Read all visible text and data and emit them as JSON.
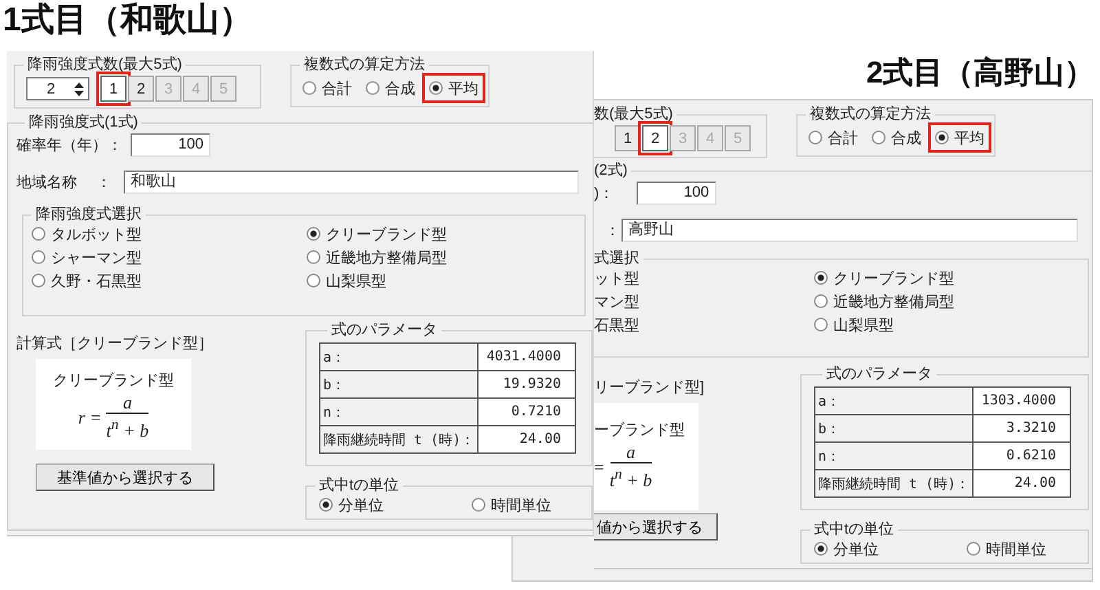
{
  "front_window": {
    "heading": "1式目（和歌山）",
    "count_group": {
      "label": "降雨強度式数(最大5式)",
      "spinner_value": "2",
      "buttons": [
        {
          "label": "1",
          "selected": true,
          "disabled": false,
          "highlighted": true
        },
        {
          "label": "2",
          "selected": false,
          "disabled": false,
          "highlighted": false
        },
        {
          "label": "3",
          "selected": false,
          "disabled": true,
          "highlighted": false
        },
        {
          "label": "4",
          "selected": false,
          "disabled": true,
          "highlighted": false
        },
        {
          "label": "5",
          "selected": false,
          "disabled": true,
          "highlighted": false
        }
      ]
    },
    "method_group": {
      "label": "複数式の算定方法",
      "options": [
        {
          "label": "合計",
          "selected": false,
          "highlighted": false
        },
        {
          "label": "合成",
          "selected": false,
          "highlighted": false
        },
        {
          "label": "平均",
          "selected": true,
          "highlighted": true
        }
      ]
    },
    "formula_group": {
      "label": "降雨強度式(1式)",
      "return_period": {
        "label": "確率年（年）：",
        "value": "100"
      },
      "region": {
        "label": "地域名称",
        "colon": "：",
        "value": "和歌山"
      },
      "type_group": {
        "label": "降雨強度式選択",
        "options": [
          {
            "kind": "radio",
            "label": "タルボット型",
            "selected": false
          },
          {
            "kind": "radio",
            "label": "クリーブランド型",
            "selected": true
          },
          {
            "kind": "radio",
            "label": "シャーマン型",
            "selected": false
          },
          {
            "kind": "radio",
            "label": "近畿地方整備局型",
            "selected": false
          },
          {
            "kind": "radio",
            "label": "久野・石黒型",
            "selected": false
          },
          {
            "kind": "radio",
            "label": "山梨県型",
            "selected": false
          }
        ]
      },
      "calc_label": "計算式［クリーブランド型］",
      "formula": {
        "name": "クリーブランド型",
        "lhs": "r",
        "equals": "=",
        "numerator": "a",
        "denominator": "t$^{n}$ + b"
      },
      "select_button": "基準値から選択する",
      "params": {
        "label": "式のパラメータ",
        "rows": [
          {
            "name": "a：",
            "value": "4031.4000"
          },
          {
            "name": "b：",
            "value": "19.9320"
          },
          {
            "name": "n：",
            "value": "0.7210"
          },
          {
            "name": "降雨継続時間 t (時)：",
            "value": "24.00"
          }
        ]
      },
      "unit_group": {
        "label": "式中tの単位",
        "options": [
          {
            "label": "分単位",
            "selected": true
          },
          {
            "label": "時間単位",
            "selected": false
          }
        ]
      }
    }
  },
  "back_window": {
    "heading": "2式目（高野山）",
    "count_group": {
      "label": "数(最大5式)",
      "buttons": [
        {
          "label": "1",
          "selected": false,
          "disabled": false,
          "highlighted": false
        },
        {
          "label": "2",
          "selected": true,
          "disabled": false,
          "highlighted": true
        },
        {
          "label": "3",
          "selected": false,
          "disabled": true,
          "highlighted": false
        },
        {
          "label": "4",
          "selected": false,
          "disabled": true,
          "highlighted": false
        },
        {
          "label": "5",
          "selected": false,
          "disabled": true,
          "highlighted": false
        }
      ]
    },
    "method_group": {
      "label": "複数式の算定方法",
      "options": [
        {
          "label": "合計",
          "selected": false,
          "highlighted": false
        },
        {
          "label": "合成",
          "selected": false,
          "highlighted": false
        },
        {
          "label": "平均",
          "selected": true,
          "highlighted": true
        }
      ]
    },
    "formula_group": {
      "label": "(2式)",
      "return_period": {
        "label": ")：",
        "value": "100"
      },
      "region": {
        "colon": "：",
        "value": "高野山"
      },
      "type_group": {
        "label": "式選択",
        "options": [
          {
            "kind": "label",
            "label": "ット型"
          },
          {
            "kind": "radio",
            "label": "クリーブランド型",
            "selected": true
          },
          {
            "kind": "label",
            "label": "マン型"
          },
          {
            "kind": "radio",
            "label": "近畿地方整備局型",
            "selected": false
          },
          {
            "kind": "label",
            "label": "石黒型"
          },
          {
            "kind": "radio",
            "label": "山梨県型",
            "selected": false
          }
        ]
      },
      "calc_label": "リーブランド型]",
      "formula": {
        "name": "ーブランド型",
        "equals": "=",
        "numerator": "a",
        "denominator": "t$^{n}$ + b"
      },
      "select_button": "値から選択する",
      "params": {
        "label": "式のパラメータ",
        "rows": [
          {
            "name": "a：",
            "value": "1303.4000"
          },
          {
            "name": "b：",
            "value": "3.3210"
          },
          {
            "name": "n：",
            "value": "0.6210"
          },
          {
            "name": "降雨継続時間 t (時)：",
            "value": "24.00"
          }
        ]
      },
      "unit_group": {
        "label": "式中tの単位",
        "options": [
          {
            "label": "分単位",
            "selected": true
          },
          {
            "label": "時間単位",
            "selected": false
          }
        ]
      }
    }
  }
}
